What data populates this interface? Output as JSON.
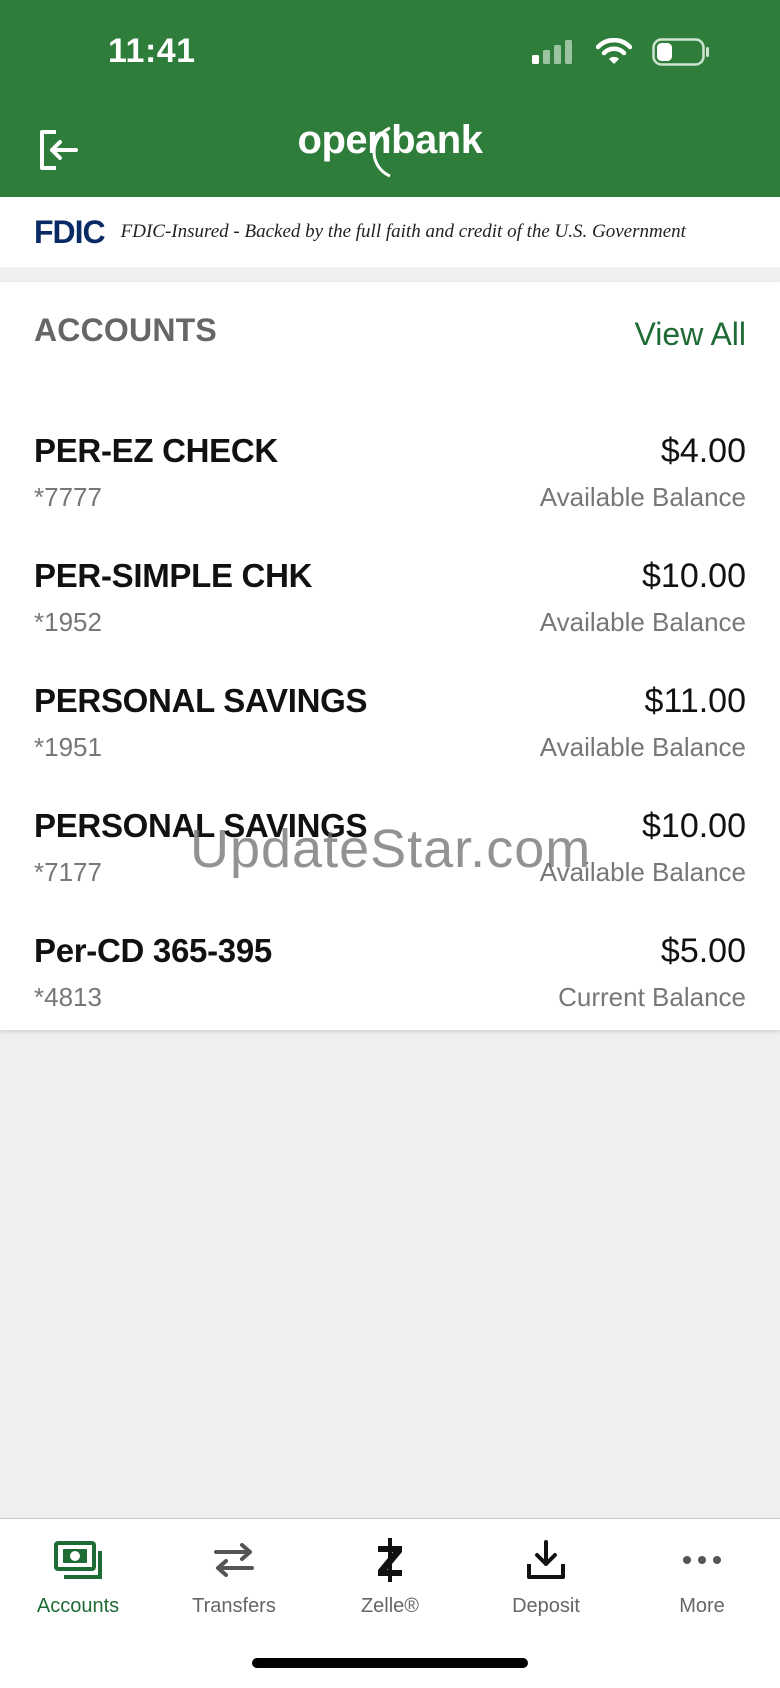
{
  "status_bar": {
    "time": "11:41"
  },
  "header": {
    "brand": "openbank"
  },
  "fdic": {
    "logo": "FDIC",
    "text": "FDIC-Insured - Backed by the full faith and credit of the U.S. Government"
  },
  "accounts": {
    "title": "ACCOUNTS",
    "view_all": "View All",
    "items": [
      {
        "name": "PER-EZ CHECK",
        "number": "*7777",
        "amount": "$4.00",
        "balance_label": "Available Balance"
      },
      {
        "name": "PER-SIMPLE CHK",
        "number": "*1952",
        "amount": "$10.00",
        "balance_label": "Available Balance"
      },
      {
        "name": "PERSONAL SAVINGS",
        "number": "*1951",
        "amount": "$11.00",
        "balance_label": "Available Balance"
      },
      {
        "name": "PERSONAL SAVINGS",
        "number": "*7177",
        "amount": "$10.00",
        "balance_label": "Available Balance"
      },
      {
        "name": "Per-CD 365-395",
        "number": "*4813",
        "amount": "$5.00",
        "balance_label": "Current Balance"
      }
    ]
  },
  "watermark": "UpdateStar.com",
  "tabbar": {
    "tabs": [
      {
        "label": "Accounts",
        "icon": "accounts-icon",
        "active": true
      },
      {
        "label": "Transfers",
        "icon": "transfers-icon",
        "active": false
      },
      {
        "label": "Zelle®",
        "icon": "zelle-icon",
        "active": false
      },
      {
        "label": "Deposit",
        "icon": "deposit-icon",
        "active": false
      },
      {
        "label": "More",
        "icon": "more-icon",
        "active": false
      }
    ]
  },
  "colors": {
    "brand_green": "#2e7d3a",
    "link_green": "#1f6b35",
    "fdic_navy": "#0a2a66"
  }
}
